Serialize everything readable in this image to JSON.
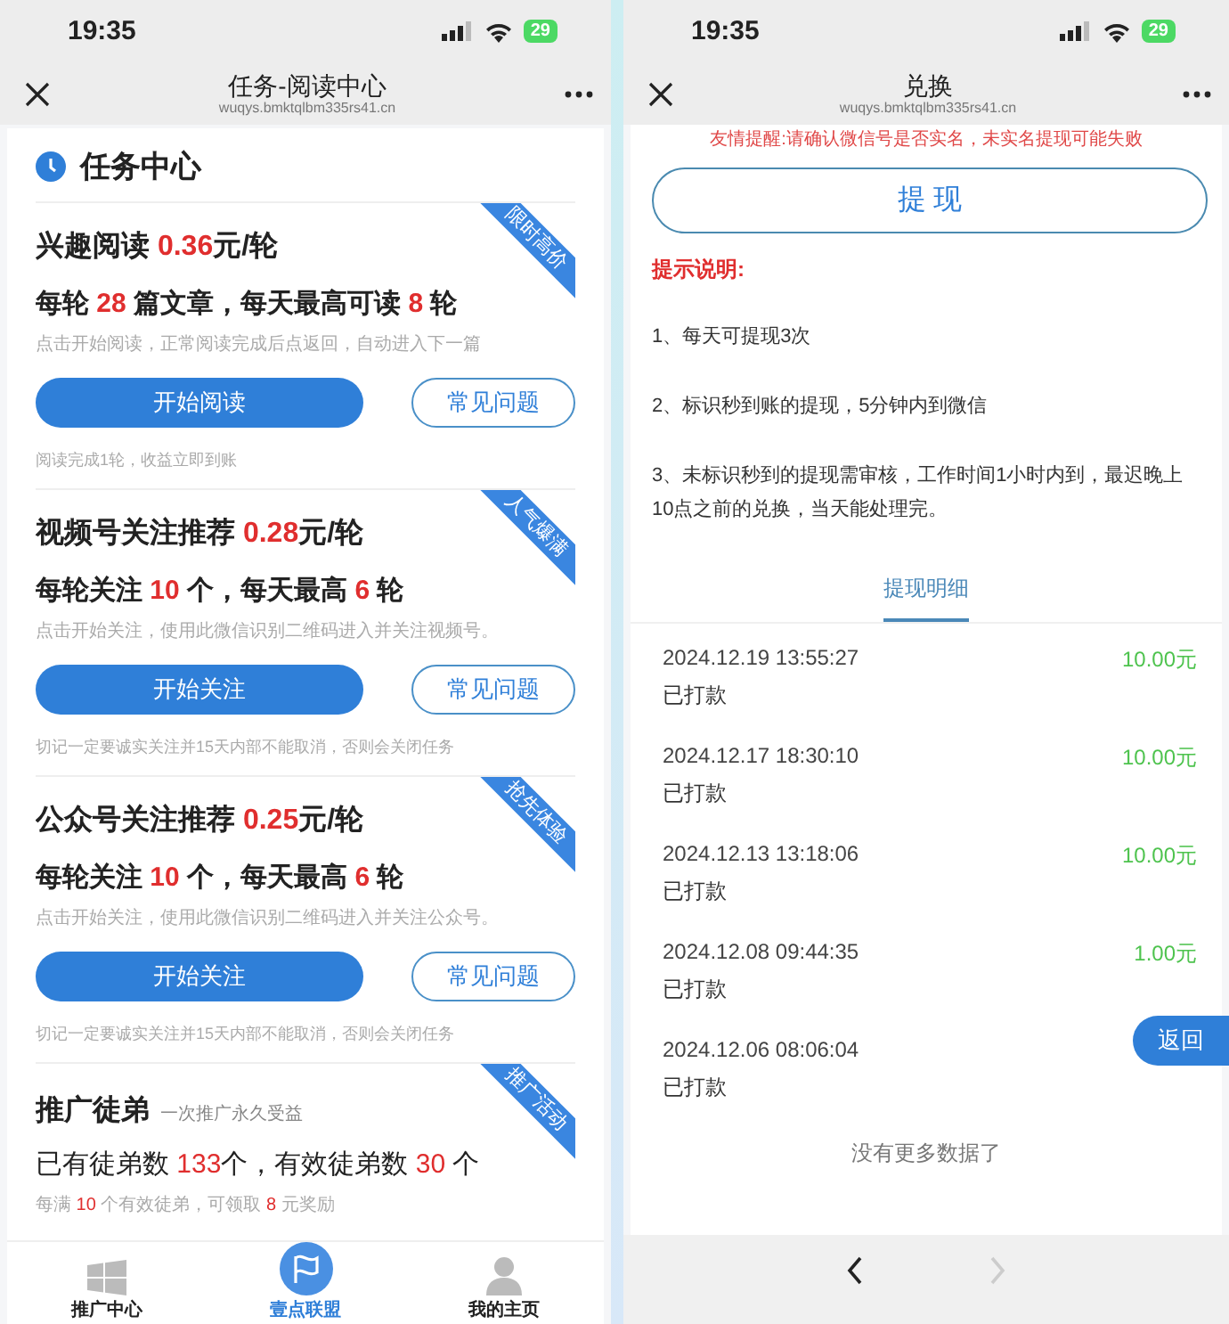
{
  "left_phone": {
    "status_bar": {
      "time": "19:35",
      "battery": "29"
    },
    "nav_bar": {
      "title": "任务-阅读中心",
      "url": "wuqys.bmktqlbm335rs41.cn"
    },
    "header": {
      "title": "任务中心"
    },
    "tasks": [
      {
        "title": [
          {
            "text": "兴趣阅读 ",
            "highlight": false
          },
          {
            "text": "0.36",
            "highlight": true
          },
          {
            "text": "元/轮",
            "highlight": false
          }
        ],
        "ribbon": "限时高价",
        "stats": [
          {
            "text": "每轮 ",
            "highlight": false
          },
          {
            "text": "28",
            "highlight": true
          },
          {
            "text": " 篇文章，每天最高可读 ",
            "highlight": false
          },
          {
            "text": "8",
            "highlight": true
          },
          {
            "text": " 轮",
            "highlight": false
          }
        ],
        "hint": "点击开始阅读，正常阅读完成后点返回，自动进入下一篇",
        "buttons": [
          {
            "label": "开始阅读",
            "kind": "primary"
          },
          {
            "label": "常见问题",
            "kind": "outline"
          }
        ],
        "footnote": "阅读完成1轮，收益立即到账"
      },
      {
        "title": [
          {
            "text": "视频号关注推荐 ",
            "highlight": false
          },
          {
            "text": "0.28",
            "highlight": true
          },
          {
            "text": "元/轮",
            "highlight": false
          }
        ],
        "ribbon": "人气爆满",
        "stats": [
          {
            "text": "每轮关注 ",
            "highlight": false
          },
          {
            "text": "10",
            "highlight": true
          },
          {
            "text": " 个，每天最高 ",
            "highlight": false
          },
          {
            "text": "6",
            "highlight": true
          },
          {
            "text": " 轮",
            "highlight": false
          }
        ],
        "hint": "点击开始关注，使用此微信识别二维码进入并关注视频号。",
        "buttons": [
          {
            "label": "开始关注",
            "kind": "primary"
          },
          {
            "label": "常见问题",
            "kind": "outline"
          }
        ],
        "footnote": "切记一定要诚实关注并15天内部不能取消，否则会关闭任务"
      },
      {
        "title": [
          {
            "text": "公众号关注推荐 ",
            "highlight": false
          },
          {
            "text": "0.25",
            "highlight": true
          },
          {
            "text": "元/轮",
            "highlight": false
          }
        ],
        "ribbon": "抢先体验",
        "stats": [
          {
            "text": "每轮关注 ",
            "highlight": false
          },
          {
            "text": "10",
            "highlight": true
          },
          {
            "text": " 个，每天最高 ",
            "highlight": false
          },
          {
            "text": "6",
            "highlight": true
          },
          {
            "text": " 轮",
            "highlight": false
          }
        ],
        "hint": "点击开始关注，使用此微信识别二维码进入并关注公众号。",
        "buttons": [
          {
            "label": "开始关注",
            "kind": "primary"
          },
          {
            "label": "常见问题",
            "kind": "outline"
          }
        ],
        "footnote": "切记一定要诚实关注并15天内部不能取消，否则会关闭任务"
      }
    ],
    "promo": {
      "title": "推广徒弟",
      "subtitle": "一次推广永久受益",
      "ribbon": "推广活动",
      "stats": [
        {
          "text": "已有徒弟数 ",
          "highlight": false
        },
        {
          "text": "133",
          "highlight": true
        },
        {
          "text": "个，有效徒弟数 ",
          "highlight": false
        },
        {
          "text": "30",
          "highlight": true
        },
        {
          "text": " 个",
          "highlight": false
        }
      ],
      "hint": [
        {
          "text": "每满 ",
          "highlight": false
        },
        {
          "text": "10",
          "highlight": true
        },
        {
          "text": " 个有效徒弟，可领取 ",
          "highlight": false
        },
        {
          "text": "8",
          "highlight": true
        },
        {
          "text": " 元奖励",
          "highlight": false
        }
      ]
    },
    "tab_bar": [
      {
        "label": "推广中心",
        "kind": "grid",
        "selected": false
      },
      {
        "label": "壹点联盟",
        "kind": "flag",
        "selected": true
      },
      {
        "label": "我的主页",
        "kind": "person",
        "selected": false
      }
    ]
  },
  "right_phone": {
    "status_bar": {
      "time": "19:35",
      "battery": "29"
    },
    "nav_bar": {
      "title": "兑换",
      "url": "wuqys.bmktqlbm335rs41.cn"
    },
    "notice": "友情提醒:请确认微信号是否实名，未实名提现可能失败",
    "withdraw_button": "提 现",
    "tips_title": "提示说明:",
    "tips": [
      "1、每天可提现3次",
      "2、标识秒到账的提现，5分钟内到微信",
      "3、未标识秒到的提现需审核，工作时间1小时内到，最迟晚上10点之前的兑换，当天能处理完。"
    ],
    "tab": {
      "label": "提现明细",
      "selected": true
    },
    "records": [
      {
        "time": "2024.12.19 13:55:27",
        "status": "已打款",
        "amount": "10.00元"
      },
      {
        "time": "2024.12.17 18:30:10",
        "status": "已打款",
        "amount": "10.00元"
      },
      {
        "time": "2024.12.13 13:18:06",
        "status": "已打款",
        "amount": "10.00元"
      },
      {
        "time": "2024.12.08 09:44:35",
        "status": "已打款",
        "amount": "1.00元"
      },
      {
        "time": "2024.12.06 08:06:04",
        "status": "已打款"
      }
    ],
    "end_text": "没有更多数据了",
    "back_button": "返回",
    "browser_bar": {
      "back_disabled": false,
      "forward_disabled": true
    }
  }
}
